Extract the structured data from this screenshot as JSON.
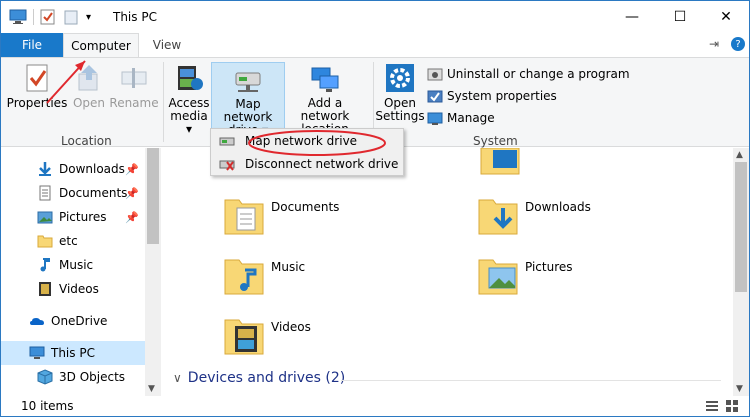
{
  "window": {
    "title": "This PC"
  },
  "titlebar": {
    "minimize": "—",
    "maximize": "☐",
    "close": "✕"
  },
  "tabs": {
    "file": "File",
    "computer": "Computer",
    "view": "View",
    "help": "?"
  },
  "ribbon": {
    "location": {
      "label": "Location",
      "properties": "Properties",
      "open": "Open",
      "rename": "Rename"
    },
    "network": {
      "access_media_l1": "Access",
      "access_media_l2": "media",
      "map_drive_l1": "Map network",
      "map_drive_l2": "drive",
      "add_location_l1": "Add a network",
      "add_location_l2": "location"
    },
    "system": {
      "label": "System",
      "open_settings_l1": "Open",
      "open_settings_l2": "Settings",
      "uninstall": "Uninstall or change a program",
      "system_properties": "System properties",
      "manage": "Manage"
    }
  },
  "dropdown": {
    "map_drive": "Map network drive",
    "disconnect": "Disconnect network drive"
  },
  "nav": {
    "items": [
      {
        "label": "Downloads",
        "icon": "download-arrow-icon",
        "pinned": true
      },
      {
        "label": "Documents",
        "icon": "document-icon",
        "pinned": true
      },
      {
        "label": "Pictures",
        "icon": "pictures-icon",
        "pinned": true
      },
      {
        "label": "etc",
        "icon": "folder-icon",
        "pinned": false
      },
      {
        "label": "Music",
        "icon": "music-note-icon",
        "pinned": false
      },
      {
        "label": "Videos",
        "icon": "film-icon",
        "pinned": false
      },
      {
        "label": "OneDrive",
        "icon": "cloud-icon",
        "pinned": false
      },
      {
        "label": "This PC",
        "icon": "computer-icon",
        "pinned": false
      },
      {
        "label": "3D Objects",
        "icon": "cube-icon",
        "pinned": false
      }
    ]
  },
  "content": {
    "folders": [
      {
        "label": "Documents"
      },
      {
        "label": "Downloads"
      },
      {
        "label": "Music"
      },
      {
        "label": "Pictures"
      },
      {
        "label": "Videos"
      }
    ],
    "devices_header": "Devices and drives (2)"
  },
  "status": {
    "items": "10 items"
  },
  "colors": {
    "accent": "#1979ca",
    "selected": "#cce8ff",
    "annotation": "#e0282e"
  }
}
